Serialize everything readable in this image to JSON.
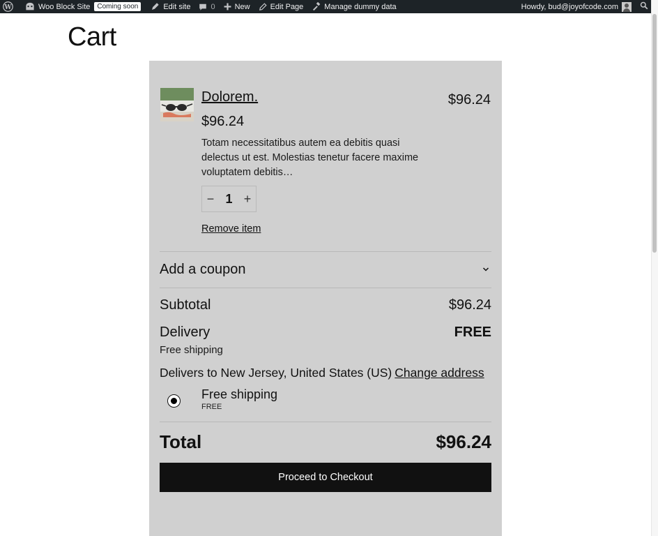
{
  "admin_bar": {
    "site_name": "Woo Block Site",
    "coming_soon": "Coming soon",
    "edit_site": "Edit site",
    "comments_count": "0",
    "new": "New",
    "edit_page": "Edit Page",
    "manage_dummy_data": "Manage dummy data",
    "howdy": "Howdy, bud@joyofcode.com"
  },
  "page": {
    "title": "Cart"
  },
  "cart": {
    "item": {
      "name": "Dolorem.",
      "price": "$96.24",
      "line_total": "$96.24",
      "description": "Totam necessitatibus autem ea debitis quasi delectus ut est. Molestias tenetur facere maxime voluptatem debitis…",
      "quantity": "1",
      "decrease_symbol": "−",
      "increase_symbol": "+",
      "remove_label": "Remove item"
    },
    "coupon_label": "Add a coupon",
    "subtotal_label": "Subtotal",
    "subtotal_value": "$96.24",
    "delivery_label": "Delivery",
    "delivery_value": "FREE",
    "delivery_method": "Free shipping",
    "delivers_to": "Delivers to New Jersey, United States (US)",
    "change_address": "Change address",
    "shipping_option": {
      "name": "Free shipping",
      "price": "FREE",
      "selected": true
    },
    "total_label": "Total",
    "total_value": "$96.24",
    "checkout_label": "Proceed to Checkout"
  },
  "icons": [
    "wordpress-icon",
    "site-icon",
    "edit-site-icon",
    "comment-icon",
    "plus-icon",
    "pencil-icon",
    "hammer-icon",
    "search-icon",
    "chevron-down-icon"
  ],
  "colors": {
    "admin_bar_bg": "#1d2327",
    "cart_panel_bg": "#d0d0d0",
    "checkout_button_bg": "#111111"
  }
}
